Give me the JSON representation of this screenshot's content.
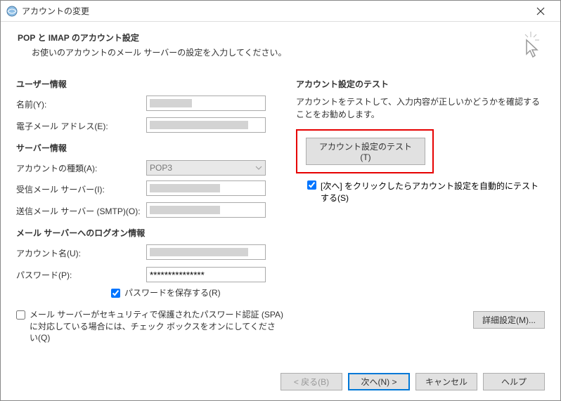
{
  "window": {
    "title": "アカウントの変更"
  },
  "header": {
    "title": "POP と IMAP のアカウント設定",
    "subtitle": "お使いのアカウントのメール サーバーの設定を入力してください。"
  },
  "sections": {
    "user": "ユーザー情報",
    "server": "サーバー情報",
    "logon": "メール サーバーへのログオン情報"
  },
  "labels": {
    "name": "名前(Y):",
    "email": "電子メール アドレス(E):",
    "accountType": "アカウントの種類(A):",
    "incoming": "受信メール サーバー(I):",
    "outgoing": "送信メール サーバー (SMTP)(O):",
    "accountName": "アカウント名(U):",
    "password": "パスワード(P):"
  },
  "values": {
    "accountType": "POP3",
    "passwordMasked": "***************"
  },
  "checks": {
    "savePassword": "パスワードを保存する(R)",
    "spa": "メール サーバーがセキュリティで保護されたパスワード認証 (SPA) に対応している場合には、チェック ボックスをオンにしてください(Q)",
    "autoTest": "[次へ] をクリックしたらアカウント設定を自動的にテストする(S)"
  },
  "testSection": {
    "title": "アカウント設定のテスト",
    "text": "アカウントをテストして、入力内容が正しいかどうかを確認することをお勧めします。",
    "button": "アカウント設定のテスト(T)"
  },
  "buttons": {
    "more": "詳細設定(M)...",
    "back": "< 戻る(B)",
    "next": "次へ(N) >",
    "cancel": "キャンセル",
    "help": "ヘルプ"
  }
}
